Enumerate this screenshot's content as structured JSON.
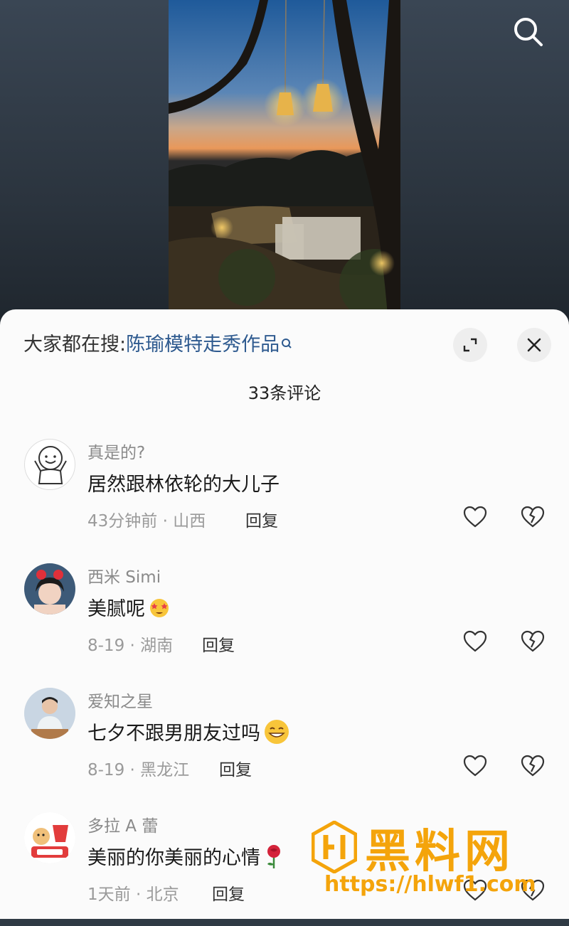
{
  "hot_search": {
    "label": "大家都在搜:",
    "term": "陈瑜模特走秀作品"
  },
  "comment_count": "33条评论",
  "comments": [
    {
      "user": "真是的?",
      "text": "居然跟林依轮的大儿子",
      "time_location": "43分钟前 · 山西",
      "reply": "回复"
    },
    {
      "user": "西米 Simi",
      "text": "美腻呢",
      "time_location": "8-19 · 湖南",
      "reply": "回复"
    },
    {
      "user": "爱知之星",
      "text": "七夕不跟男朋友过吗",
      "time_location": "8-19 · 黑龙江",
      "reply": "回复"
    },
    {
      "user": "多拉 A 蕾",
      "text": "美丽的你美丽的心情",
      "time_location": "1天前 · 北京",
      "reply": "回复"
    }
  ],
  "watermark": {
    "title": "黑料网",
    "url": "https://hlwf1.com"
  },
  "icons": {
    "search": "search-icon",
    "expand": "expand-icon",
    "close": "close-icon",
    "like": "heart-icon",
    "dislike": "broken-heart-icon"
  },
  "colors": {
    "accent_link": "#2e5a8f",
    "watermark": "#f4a40b"
  }
}
